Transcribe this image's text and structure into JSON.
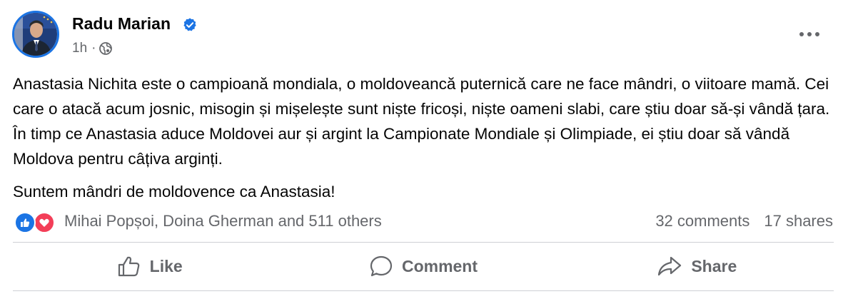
{
  "author": {
    "name": "Radu Marian",
    "avatar_icon": "profile-photo",
    "verified_icon": "verified-badge-icon"
  },
  "meta": {
    "time": "1h",
    "separator": "·",
    "audience_icon": "globe-icon"
  },
  "menu": {
    "more_icon": "more-options-icon"
  },
  "post": {
    "paragraphs": [
      "Anastasia Nichita este o campioană mondiala, o moldoveancă puternică care ne face mândri, o viitoare mamă. Cei care o atacă acum josnic, misogin și mișelește sunt niște fricoși, niște oameni slabi, care știu doar să-și vândă țara. În timp ce Anastasia aduce Moldovei aur și argint la Campionate Mondiale și Olimpiade, ei știu doar să vândă Moldova pentru câțiva arginți.",
      "Suntem mândri de moldovence ca Anastasia!"
    ]
  },
  "reactions": {
    "icons": [
      "like-reaction-icon",
      "love-reaction-icon"
    ],
    "summary": "Mihai Popșoi, Doina Gherman and 511 others"
  },
  "counts": {
    "comments": "32 comments",
    "shares": "17 shares"
  },
  "actions": {
    "like": "Like",
    "comment": "Comment",
    "share": "Share"
  },
  "colors": {
    "accent": "#1b74e4",
    "love": "#f33e58",
    "secondary_text": "#65676b",
    "primary_text": "#050505",
    "divider": "#ced0d4"
  }
}
